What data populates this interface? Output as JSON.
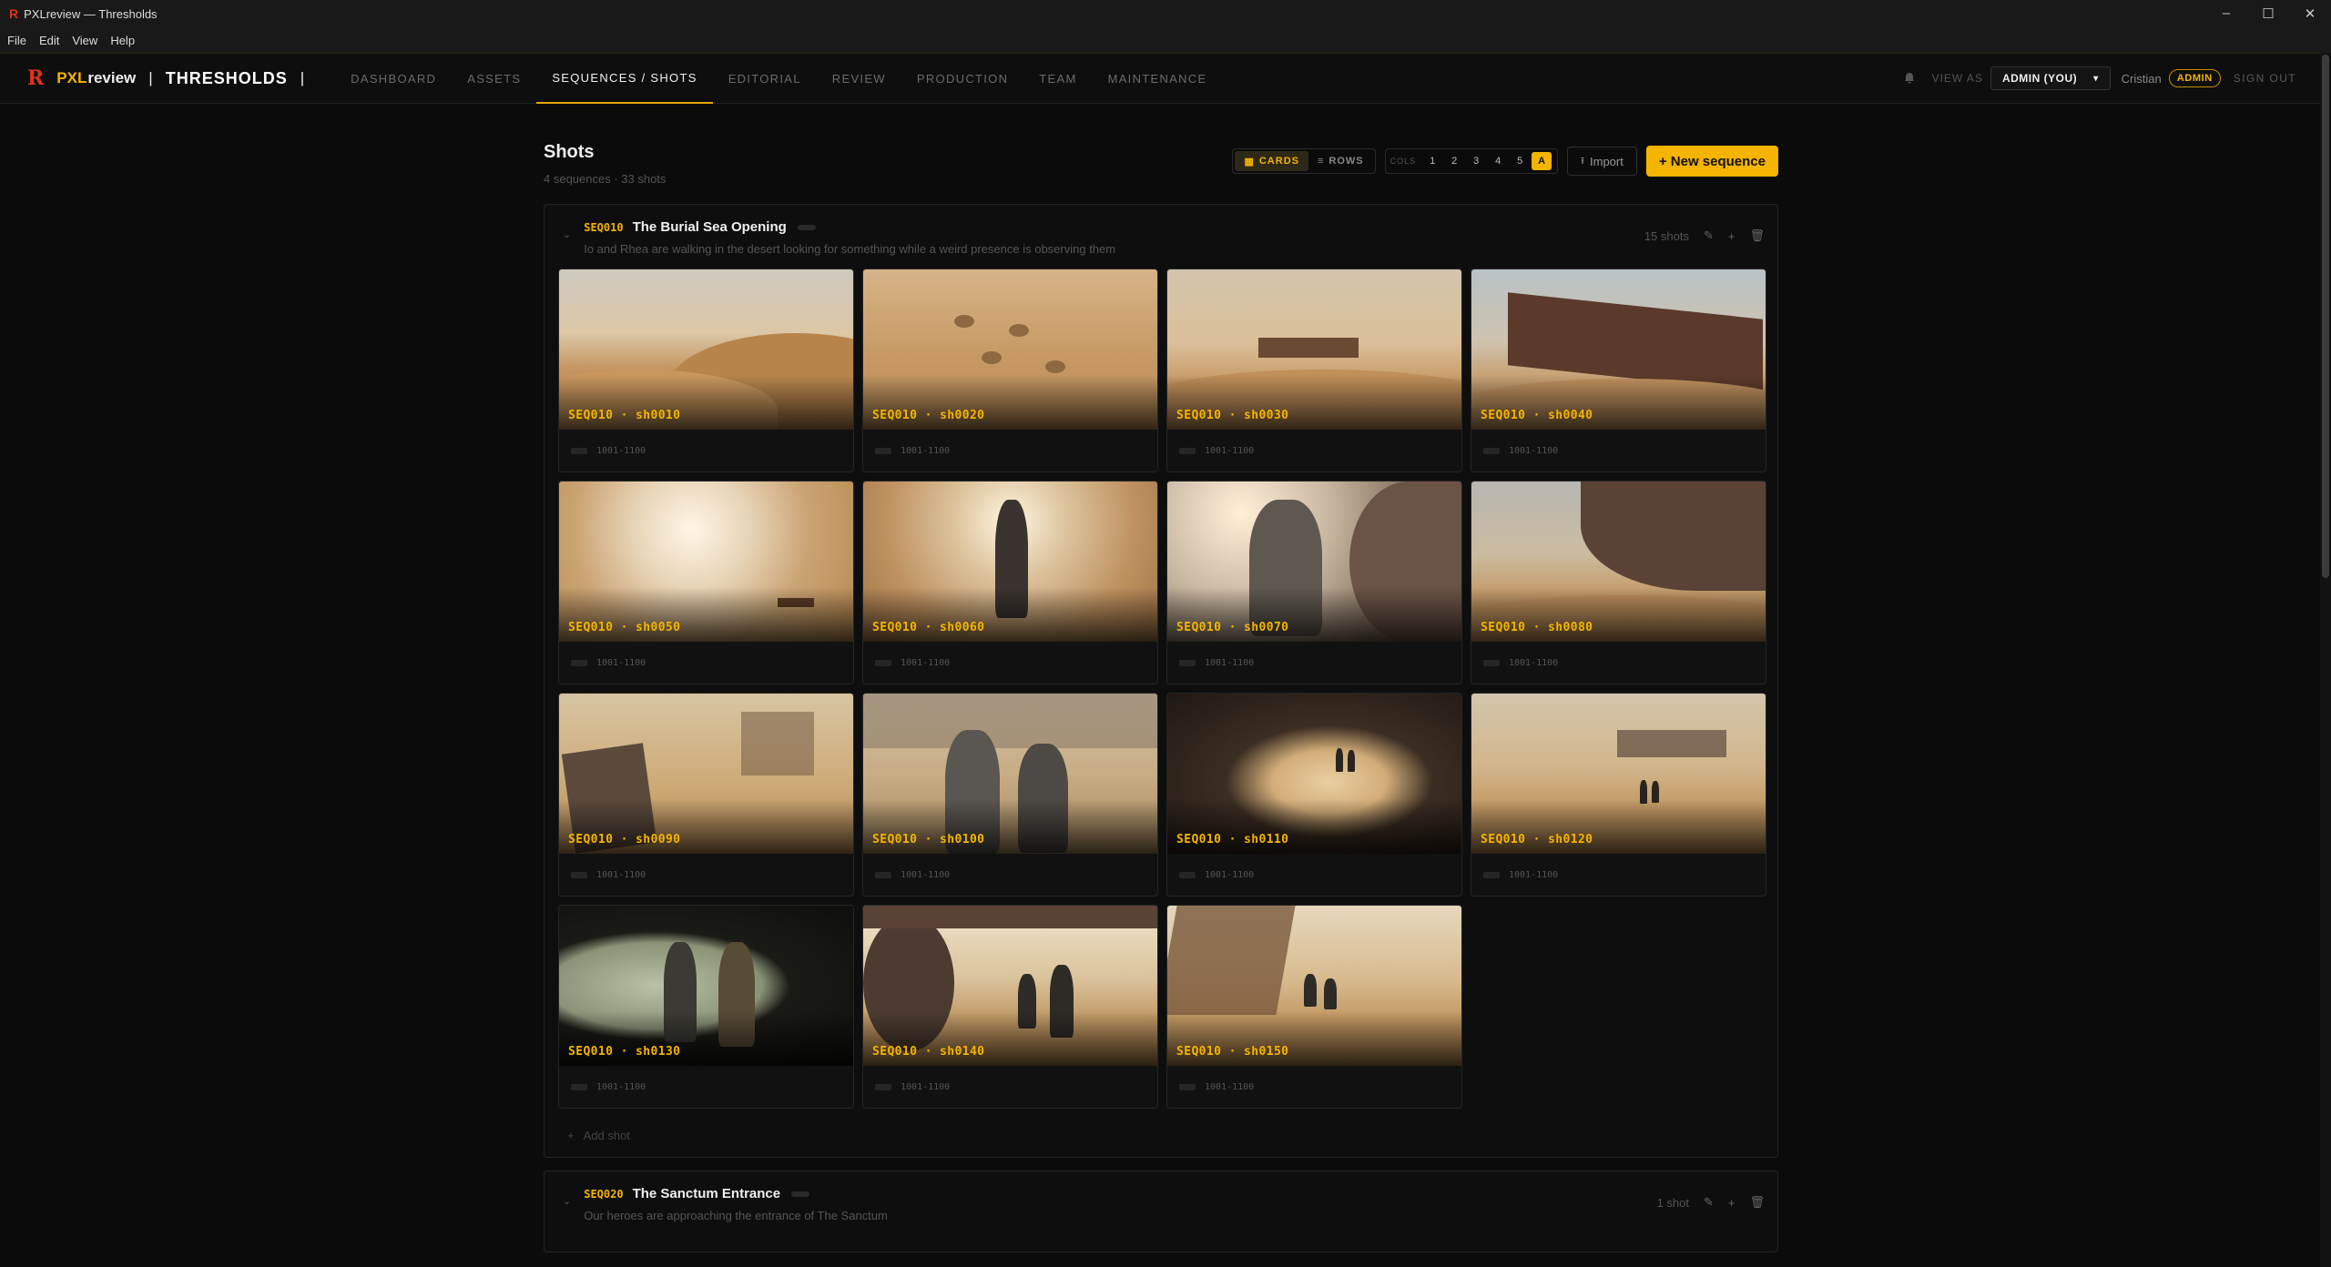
{
  "window": {
    "title": "PXLreview — Thresholds",
    "icon": "r-logo-icon",
    "controls": [
      "–",
      "☐",
      "✕"
    ]
  },
  "menubar": [
    "File",
    "Edit",
    "View",
    "Help"
  ],
  "nav": {
    "brand_pxl": "PXL",
    "brand_review": "review",
    "separator": "|",
    "project": "THRESHOLDS",
    "tabs": [
      {
        "label": "DASHBOARD",
        "active": false
      },
      {
        "label": "ASSETS",
        "active": false
      },
      {
        "label": "SEQUENCES / SHOTS",
        "active": true
      },
      {
        "label": "EDITORIAL",
        "active": false
      },
      {
        "label": "REVIEW",
        "active": false
      },
      {
        "label": "PRODUCTION",
        "active": false
      },
      {
        "label": "TEAM",
        "active": false
      },
      {
        "label": "MAINTENANCE",
        "active": false
      }
    ],
    "view_as_label": "VIEW AS",
    "view_as_value": "ADMIN (YOU)",
    "user": "Cristian",
    "role_badge": "ADMIN",
    "sign_out": "SIGN OUT"
  },
  "page": {
    "title": "Shots",
    "subtitle": "4 sequences · 33 shots",
    "view_toggle": {
      "cards": "CARDS",
      "rows": "ROWS",
      "active": "cards"
    },
    "cols_label": "COLS",
    "cols_options": [
      "1",
      "2",
      "3",
      "4",
      "5",
      "A"
    ],
    "cols_selected": "A",
    "import_label": "Import",
    "new_sequence_label": "+ New sequence",
    "add_shot_label": "Add shot"
  },
  "sequences": [
    {
      "code": "SEQ010",
      "name": "The Burial Sea Opening",
      "description": "Io and Rhea are walking in the desert looking for something while a weird presence is observing them",
      "shot_count": "15 shots",
      "shots": [
        {
          "code": "SEQ010 · sh0010",
          "range": "1001-1100"
        },
        {
          "code": "SEQ010 · sh0020",
          "range": "1001-1100"
        },
        {
          "code": "SEQ010 · sh0030",
          "range": "1001-1100"
        },
        {
          "code": "SEQ010 · sh0040",
          "range": "1001-1100"
        },
        {
          "code": "SEQ010 · sh0050",
          "range": "1001-1100"
        },
        {
          "code": "SEQ010 · sh0060",
          "range": "1001-1100"
        },
        {
          "code": "SEQ010 · sh0070",
          "range": "1001-1100"
        },
        {
          "code": "SEQ010 · sh0080",
          "range": "1001-1100"
        },
        {
          "code": "SEQ010 · sh0090",
          "range": "1001-1100"
        },
        {
          "code": "SEQ010 · sh0100",
          "range": "1001-1100"
        },
        {
          "code": "SEQ010 · sh0110",
          "range": "1001-1100"
        },
        {
          "code": "SEQ010 · sh0120",
          "range": "1001-1100"
        },
        {
          "code": "SEQ010 · sh0130",
          "range": "1001-1100"
        },
        {
          "code": "SEQ010 · sh0140",
          "range": "1001-1100"
        },
        {
          "code": "SEQ010 · sh0150",
          "range": "1001-1100"
        }
      ]
    },
    {
      "code": "SEQ020",
      "name": "The Sanctum Entrance",
      "description": "Our heroes are approaching the entrance of The Sanctum",
      "shot_count": "1 shot",
      "shots": []
    }
  ],
  "colors": {
    "accent": "#f5b400",
    "brand_red": "#e0321e",
    "background": "#0b0b0b"
  }
}
